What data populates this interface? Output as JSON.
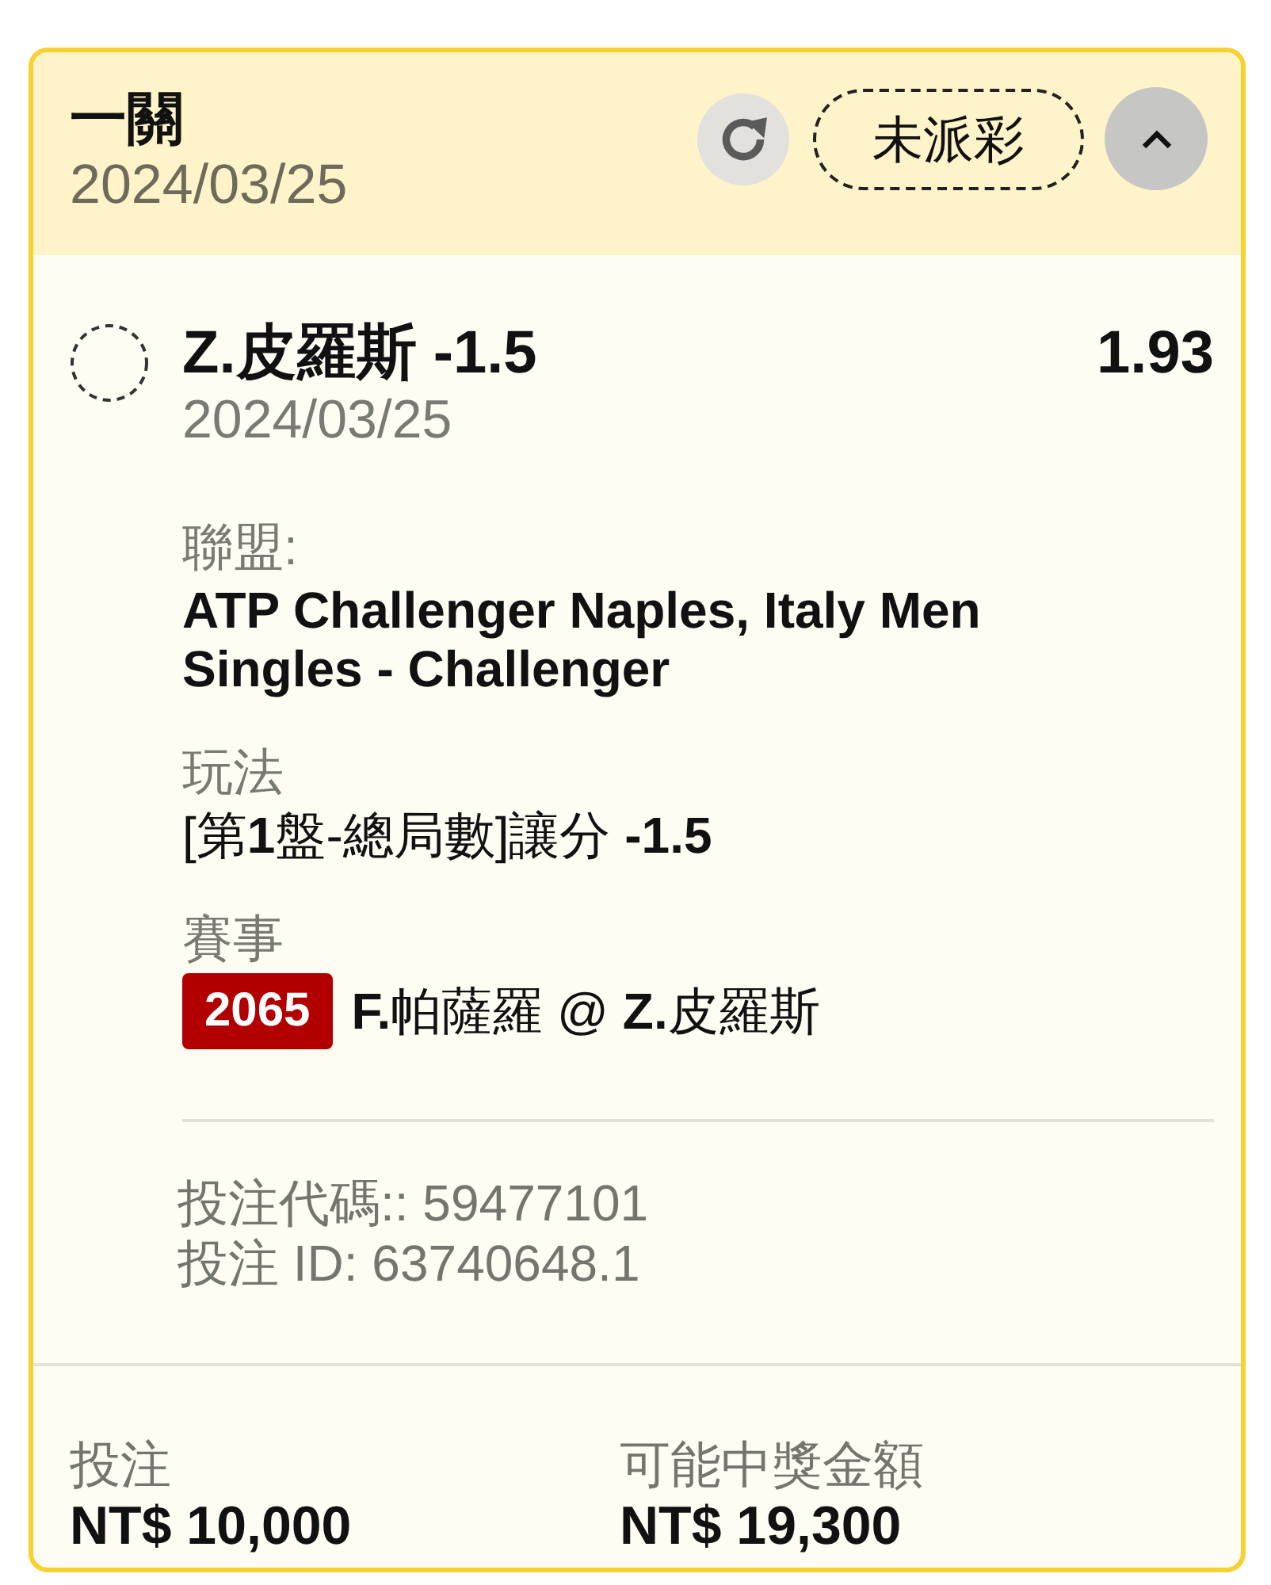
{
  "bet": {
    "type_label": "一關",
    "date": "2024/03/25",
    "status": "未派彩",
    "expanded": true
  },
  "selection": {
    "name": "Z.皮羅斯 -1.5",
    "odds": "1.93",
    "date": "2024/03/25"
  },
  "details": [
    {
      "label": "聯盟:",
      "value": "ATP Challenger Naples, Italy Men Singles - Challenger"
    },
    {
      "label": "玩法",
      "value": "[第**1**盤-總局數]讓分 **-1.5**"
    },
    {
      "label": "賽事",
      "match_number": "2065",
      "value": "**F.**帕薩羅 @ **Z.**皮羅斯"
    }
  ],
  "references": [
    "投注代碼:: 59477101",
    "投注 ID: 63740648.1"
  ],
  "totals": [
    {
      "label": "投注",
      "amount": "NT$ 10,000"
    },
    {
      "label": "可能中獎金額",
      "amount": "NT$ 19,300"
    }
  ]
}
